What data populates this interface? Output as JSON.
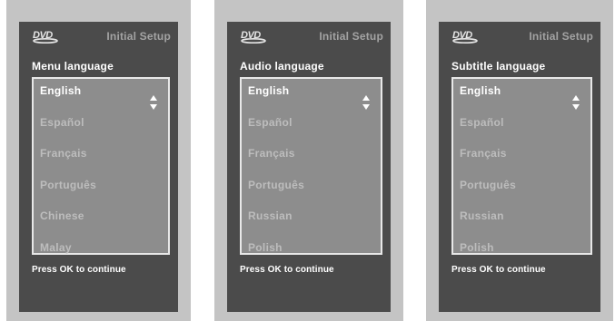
{
  "screens": [
    {
      "title": "Initial Setup",
      "section_label": "Menu language",
      "options": [
        "English",
        "Español",
        "Français",
        "Português",
        "Chinese",
        "Malay"
      ],
      "selected": "English",
      "footer": "Press OK to continue"
    },
    {
      "title": "Initial Setup",
      "section_label": "Audio language",
      "options": [
        "English",
        "Español",
        "Français",
        "Português",
        "Russian",
        "Polish"
      ],
      "selected": "English",
      "footer": "Press OK to continue"
    },
    {
      "title": "Initial Setup",
      "section_label": "Subtitle language",
      "options": [
        "English",
        "Español",
        "Français",
        "Português",
        "Russian",
        "Polish"
      ],
      "selected": "English",
      "footer": "Press OK to continue"
    }
  ],
  "logo": {
    "text": "DVD",
    "icon": "dvd-logo-icon"
  },
  "scroll_icon": "up-down-arrows-icon",
  "colors": {
    "outer_frame": "#c4c4c4",
    "screen_bg": "#4b4b4b",
    "list_bg": "#8d8d8d",
    "selected_text": "#ffffff",
    "option_text": "#bdbdbd",
    "title_text": "#a3a3a3"
  }
}
